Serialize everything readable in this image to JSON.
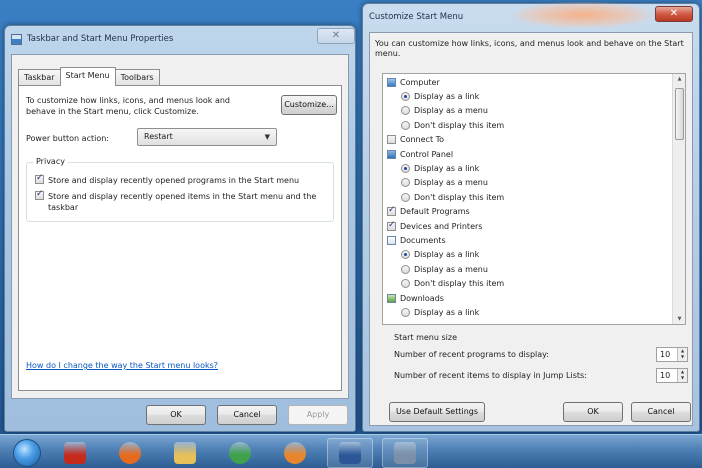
{
  "left_window": {
    "title": "Taskbar and Start Menu Properties",
    "close_label": "✕",
    "tabs": [
      {
        "label": "Taskbar"
      },
      {
        "label": "Start Menu"
      },
      {
        "label": "Toolbars"
      }
    ],
    "description": "To customize how links, icons, and menus look and behave in the Start menu, click Customize.",
    "customize_label": "Customize...",
    "power_label": "Power button action:",
    "power_value": "Restart",
    "privacy": {
      "title": "Privacy",
      "items": [
        {
          "label": "Store and display recently opened programs in the Start menu",
          "checked": true
        },
        {
          "label": "Store and display recently opened items in the Start menu and the taskbar",
          "checked": true
        }
      ]
    },
    "help_link": "How do I change the way the Start menu looks?",
    "buttons": {
      "ok": "OK",
      "cancel": "Cancel",
      "apply": "Apply"
    }
  },
  "right_window": {
    "title": "Customize Start Menu",
    "close_label": "✕",
    "description": "You can customize how links, icons, and menus look and behave on the Start menu.",
    "items": [
      {
        "label": "Computer",
        "kind": "header",
        "icon": "computer-icon"
      },
      {
        "label": "Display as a link",
        "kind": "radio",
        "selected": true
      },
      {
        "label": "Display as a menu",
        "kind": "radio",
        "selected": false
      },
      {
        "label": "Don't display this item",
        "kind": "radio",
        "selected": false
      },
      {
        "label": "Connect To",
        "kind": "check",
        "checked": false
      },
      {
        "label": "Control Panel",
        "kind": "header",
        "icon": "control-panel-icon"
      },
      {
        "label": "Display as a link",
        "kind": "radio",
        "selected": true
      },
      {
        "label": "Display as a menu",
        "kind": "radio",
        "selected": false
      },
      {
        "label": "Don't display this item",
        "kind": "radio",
        "selected": false
      },
      {
        "label": "Default Programs",
        "kind": "check",
        "checked": true
      },
      {
        "label": "Devices and Printers",
        "kind": "check",
        "checked": true
      },
      {
        "label": "Documents",
        "kind": "header",
        "icon": "documents-icon"
      },
      {
        "label": "Display as a link",
        "kind": "radio",
        "selected": true
      },
      {
        "label": "Display as a menu",
        "kind": "radio",
        "selected": false
      },
      {
        "label": "Don't display this item",
        "kind": "radio",
        "selected": false
      },
      {
        "label": "Downloads",
        "kind": "header",
        "icon": "downloads-icon"
      },
      {
        "label": "Display as a link",
        "kind": "radio",
        "selected": false
      }
    ],
    "start_menu_size": {
      "title": "Start menu size",
      "recent_programs_label": "Number of recent programs to display:",
      "recent_programs_value": "10",
      "jump_list_label": "Number of recent items to display in Jump Lists:",
      "jump_list_value": "10"
    },
    "buttons": {
      "defaults": "Use Default Settings",
      "ok": "OK",
      "cancel": "Cancel"
    }
  },
  "taskbar": {
    "items": [
      {
        "name": "start-orb-icon",
        "color": "#2f7ed8"
      },
      {
        "name": "adobe-reader-icon",
        "color": "#c62a1c"
      },
      {
        "name": "firefox-icon",
        "color": "#e66a1c"
      },
      {
        "name": "file-explorer-icon",
        "color": "#e8c05a"
      },
      {
        "name": "chrome-icon",
        "color": "#3fa14a"
      },
      {
        "name": "media-player-icon",
        "color": "#e9862b"
      },
      {
        "name": "word-icon",
        "color": "#2b5797"
      },
      {
        "name": "control-panel-taskbar-icon",
        "color": "#7b8fa8"
      }
    ]
  }
}
